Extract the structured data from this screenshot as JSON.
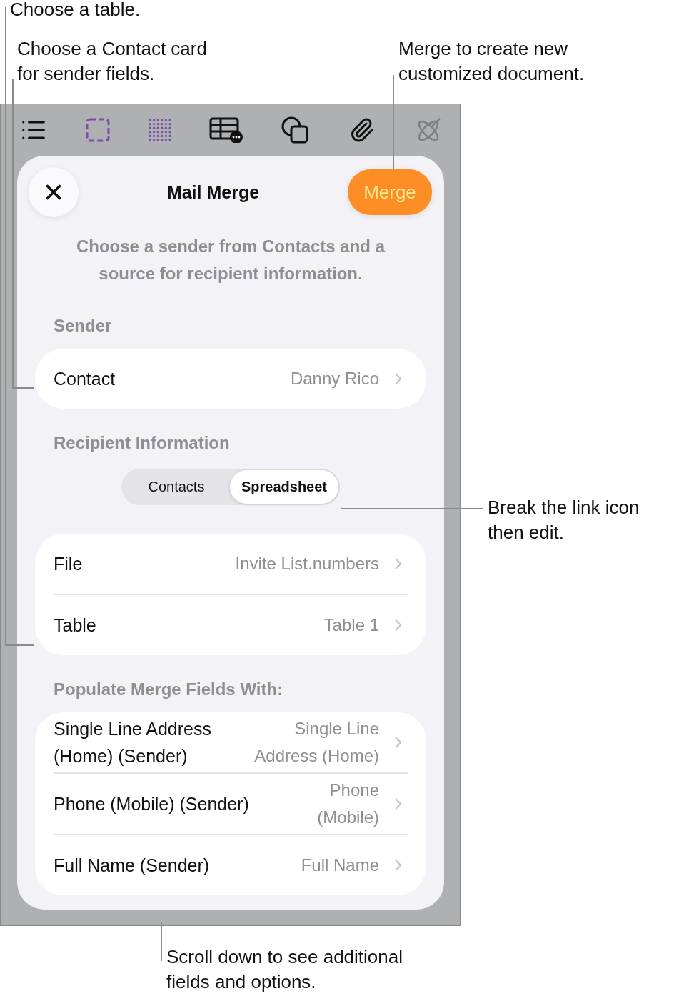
{
  "callouts": [
    {
      "text": "Choose a table."
    },
    {
      "text": "Choose a Contact card\nfor sender fields."
    },
    {
      "text": "Merge to create new\ncustomized document."
    },
    {
      "text": "Break the link icon\nthen edit."
    },
    {
      "text": "Scroll down to see additional\nfields and options."
    }
  ],
  "sheet": {
    "title": "Mail Merge",
    "merge_button": "Merge",
    "description": "Choose a sender from Contacts and a\nsource for recipient information.",
    "sender": {
      "heading": "Sender",
      "rows": [
        {
          "label": "Contact",
          "value": "Danny Rico"
        }
      ]
    },
    "recipient": {
      "heading": "Recipient Information",
      "segments": [
        {
          "label": "Contacts",
          "selected": false
        },
        {
          "label": "Spreadsheet",
          "selected": true
        }
      ],
      "rows": [
        {
          "label": "File",
          "value": "Invite List.numbers"
        },
        {
          "label": "Table",
          "value": "Table 1"
        }
      ]
    },
    "merge_fields": {
      "heading": "Populate Merge Fields With:",
      "rows": [
        {
          "label": "Single Line Address\n(Home) (Sender)",
          "value": "Single Line\nAddress (Home)"
        },
        {
          "label": "Phone (Mobile) (Sender)",
          "value": "Phone\n(Mobile)"
        },
        {
          "label": "Full Name (Sender)",
          "value": "Full Name"
        }
      ]
    }
  }
}
